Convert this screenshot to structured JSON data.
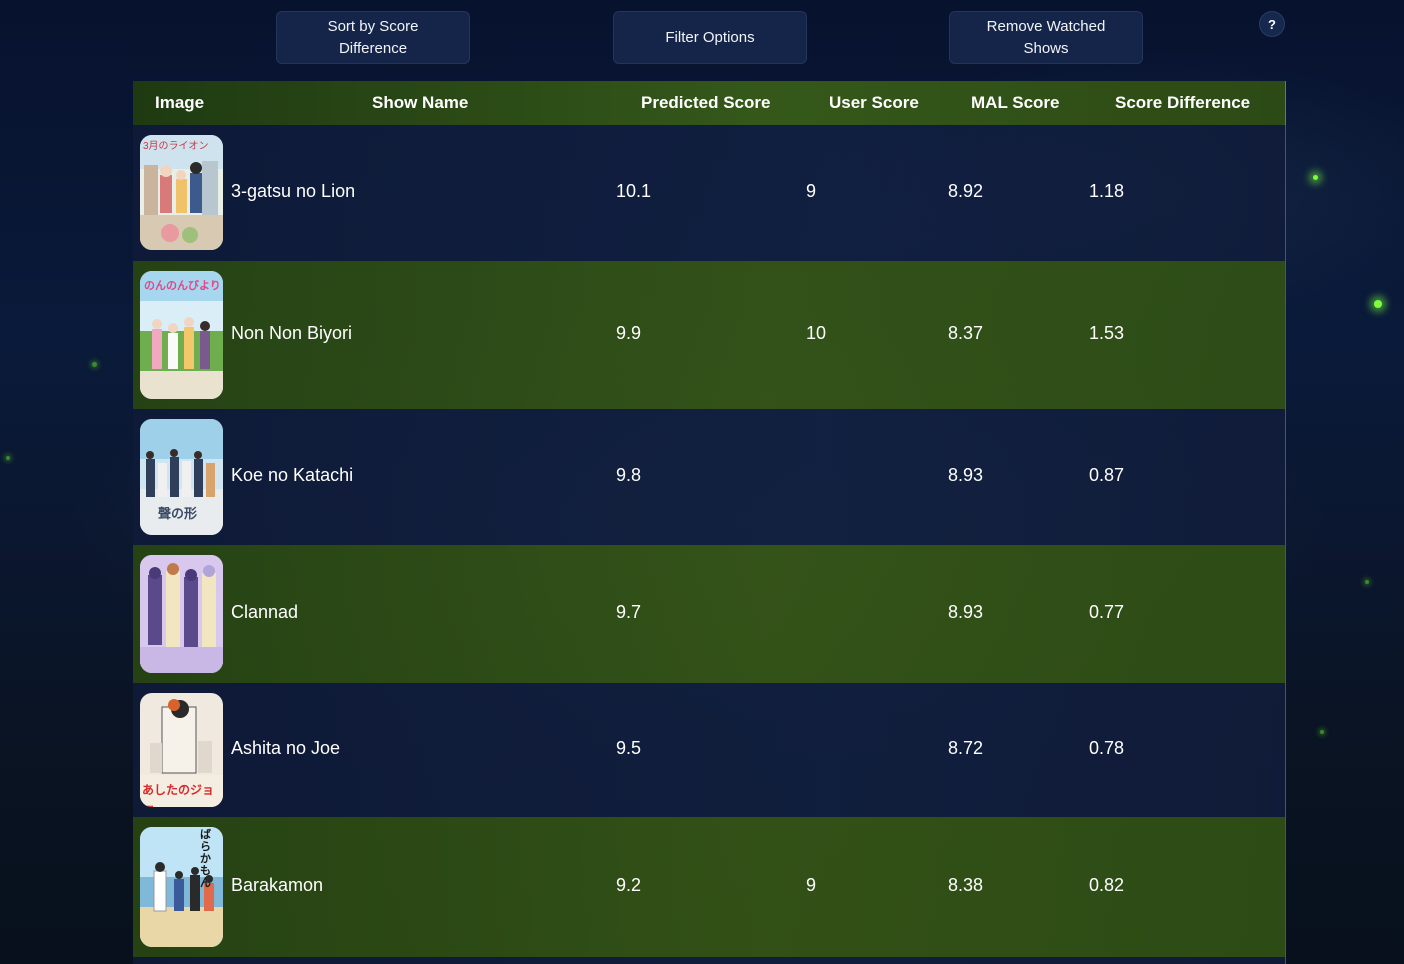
{
  "toolbar": {
    "sort_label": "Sort by Score Difference",
    "filter_label": "Filter Options",
    "remove_label": "Remove Watched Shows",
    "help_label": "?"
  },
  "table": {
    "headers": [
      "Image",
      "Show Name",
      "Predicted Score",
      "User Score",
      "MAL Score",
      "Score Difference"
    ],
    "rows": [
      {
        "name": "3-gatsu no Lion",
        "predicted": "10.1",
        "user": "9",
        "mal": "8.92",
        "diff": "1.18",
        "poster_title": "3月のライオン"
      },
      {
        "name": "Non Non Biyori",
        "predicted": "9.9",
        "user": "10",
        "mal": "8.37",
        "diff": "1.53",
        "poster_title": "のんのんびより"
      },
      {
        "name": "Koe no Katachi",
        "predicted": "9.8",
        "user": "",
        "mal": "8.93",
        "diff": "0.87",
        "poster_title": "聲の形"
      },
      {
        "name": "Clannad",
        "predicted": "9.7",
        "user": "",
        "mal": "8.93",
        "diff": "0.77",
        "poster_title": ""
      },
      {
        "name": "Ashita no Joe",
        "predicted": "9.5",
        "user": "",
        "mal": "8.72",
        "diff": "0.78",
        "poster_title": "あしたのジョー"
      },
      {
        "name": "Barakamon",
        "predicted": "9.2",
        "user": "9",
        "mal": "8.38",
        "diff": "0.82",
        "poster_title": "ばらかもん"
      }
    ]
  },
  "colors": {
    "header_green": "#35581a",
    "row_dark": "#121f42",
    "row_green": "#375816",
    "button_bg": "#15254a",
    "firefly": "#7dff3a"
  }
}
